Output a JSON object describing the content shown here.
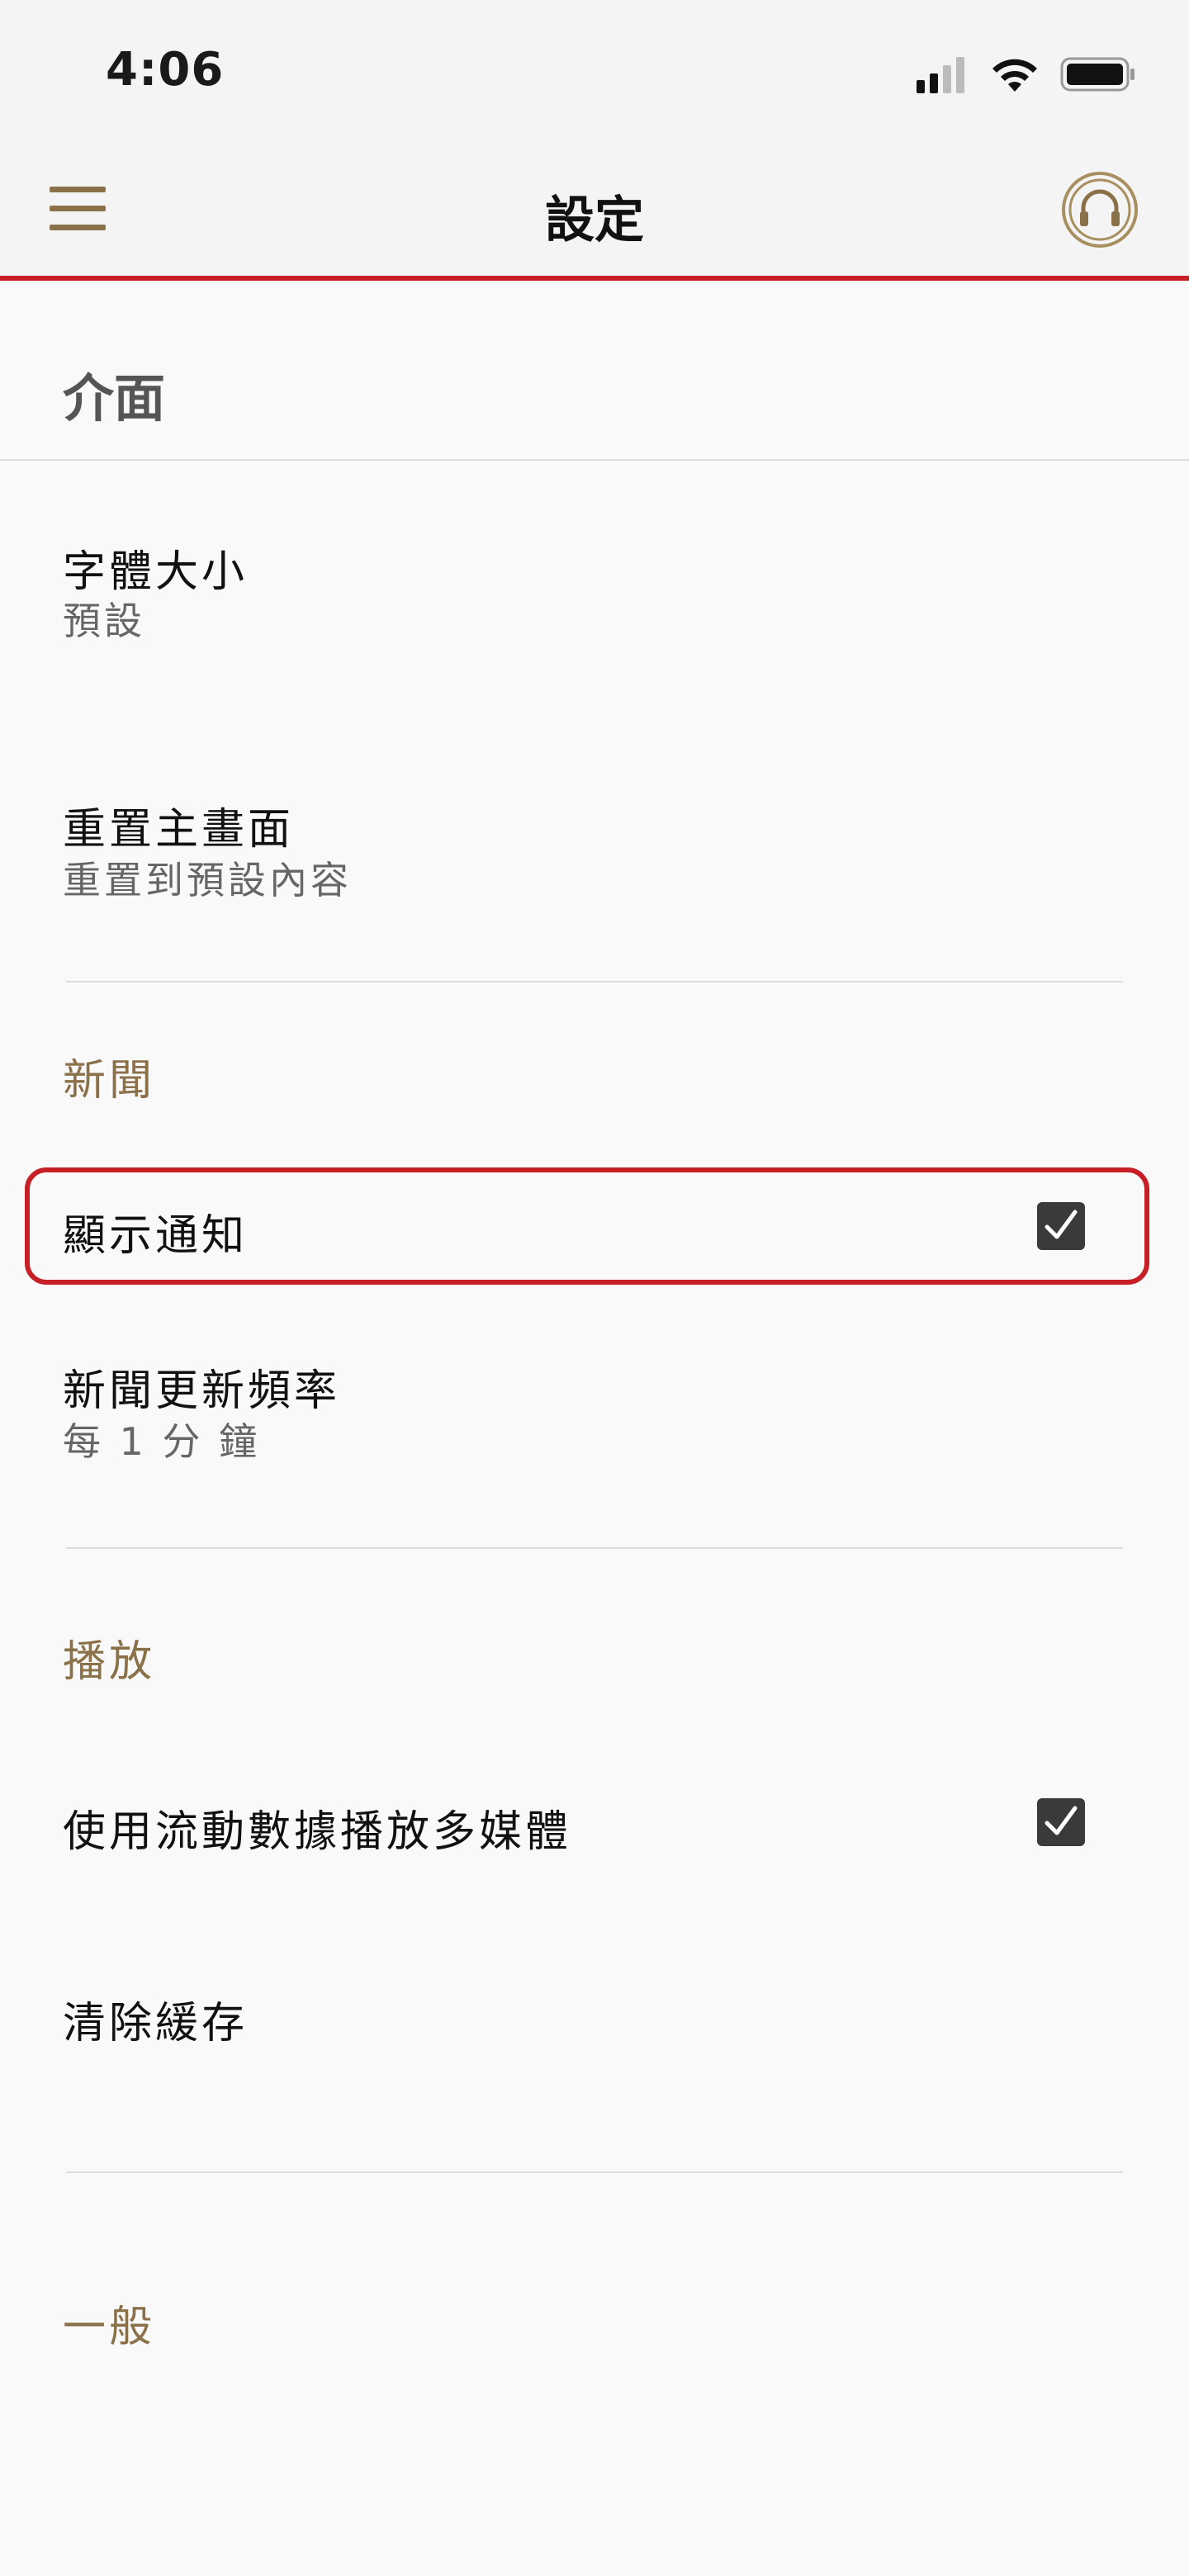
{
  "status_bar": {
    "time": "4:06",
    "icons": [
      "cellular-signal-icon",
      "wifi-icon",
      "battery-icon"
    ]
  },
  "header": {
    "title": "設定",
    "menu_icon": "hamburger-menu-icon",
    "audio_icon": "headphones-icon"
  },
  "sections": {
    "interface": {
      "label": "介面",
      "items": {
        "font_size": {
          "title": "字體大小",
          "subtitle": "預設"
        },
        "reset_home": {
          "title": "重置主畫面",
          "subtitle": "重置到預設內容"
        }
      }
    },
    "news": {
      "label": "新聞",
      "items": {
        "show_notifications": {
          "title": "顯示通知",
          "checked": true
        },
        "update_frequency": {
          "title": "新聞更新頻率",
          "subtitle": "每 1 分 鐘"
        }
      }
    },
    "playback": {
      "label": "播放",
      "items": {
        "mobile_data": {
          "title": "使用流動數據播放多媒體",
          "checked": true
        },
        "clear_cache": {
          "title": "清除緩存"
        }
      }
    },
    "general": {
      "label": "一般"
    }
  },
  "colors": {
    "accent_red": "#c62026",
    "accent_gold": "#8b7149",
    "checkbox": "#3a3a3a"
  }
}
